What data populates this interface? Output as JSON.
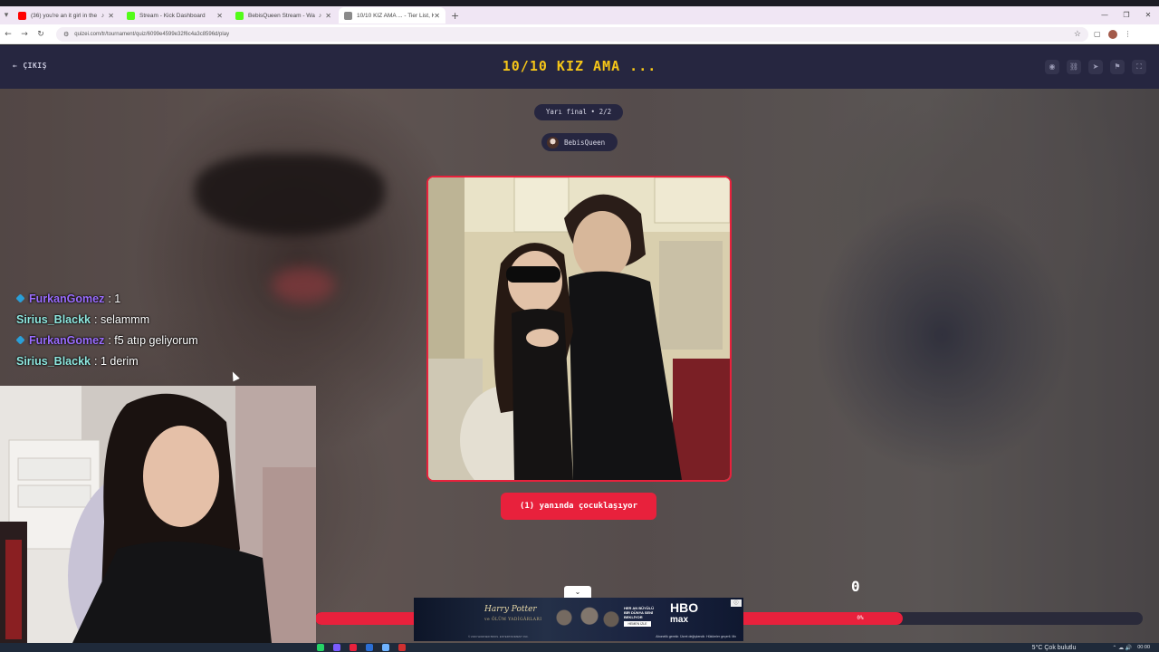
{
  "browser": {
    "tabs": [
      {
        "title": "(36) you're an it girl in the",
        "favicon_color": "#ff0000",
        "audio": true
      },
      {
        "title": "Stream - Kick Dashboard",
        "favicon_color": "#53fc18",
        "audio": false
      },
      {
        "title": "BebisQueen Stream - Watc",
        "favicon_color": "#53fc18",
        "audio": true
      },
      {
        "title": "10/10 KIZ AMA ... - Tier List, Ko",
        "favicon_color": "#8a8a8a",
        "audio": false,
        "active": true
      }
    ],
    "url": "quizei.com/tr/tournament/quiz/6099e4599e32f6c4a3c8596d/play"
  },
  "header": {
    "exit_label": "ÇIKIŞ",
    "title": "10/10 KIZ AMA ...",
    "icons": [
      "eye-icon",
      "link-icon",
      "send-icon",
      "flag-icon",
      "fullscreen-icon"
    ]
  },
  "round": {
    "label": "Yarı final • 2/2"
  },
  "author": {
    "name": "BebisQueen"
  },
  "choice": {
    "caption": "(1) yanında çocuklaşıyor"
  },
  "score": {
    "value": "0"
  },
  "progress": {
    "label": "0%",
    "fraction": 0.71
  },
  "ad": {
    "brand": "Harry Potter",
    "sub": "ve ÖLÜM YADİGÂRLARI",
    "promo": "HER AN BÜYÜLÜ BİR DÜNYA SENİ BEKLİYOR",
    "promo_cta": "HEMEN İZLE",
    "hbo_top": "HBO",
    "hbo_bottom": "max",
    "note": "Abonelik gerekir. Ücret değişkendir. Hükümler geçerli. Mx",
    "footnote": "© 2023 WARNER BROS. ENTERTAINMENT INC."
  },
  "chat": [
    {
      "user": "FurkanGomez",
      "message": ": 1",
      "user_color": "#9b6dff",
      "badge": true
    },
    {
      "user": "Sirius_Blackk",
      "message": ": selammm",
      "user_color": "#8fe8e0",
      "badge": false
    },
    {
      "user": "FurkanGomez",
      "message": ": f5 atıp geliyorum",
      "user_color": "#9b6dff",
      "badge": true
    },
    {
      "user": "Sirius_Blackk",
      "message": ": 1 derim",
      "user_color": "#8fe8e0",
      "badge": false
    }
  ],
  "taskbar": {
    "weather": "5°C  Çok bulutlu",
    "clock": "00:00"
  },
  "colors": {
    "accent": "#e8213c",
    "title": "#f5c518",
    "bar": "#262640"
  }
}
